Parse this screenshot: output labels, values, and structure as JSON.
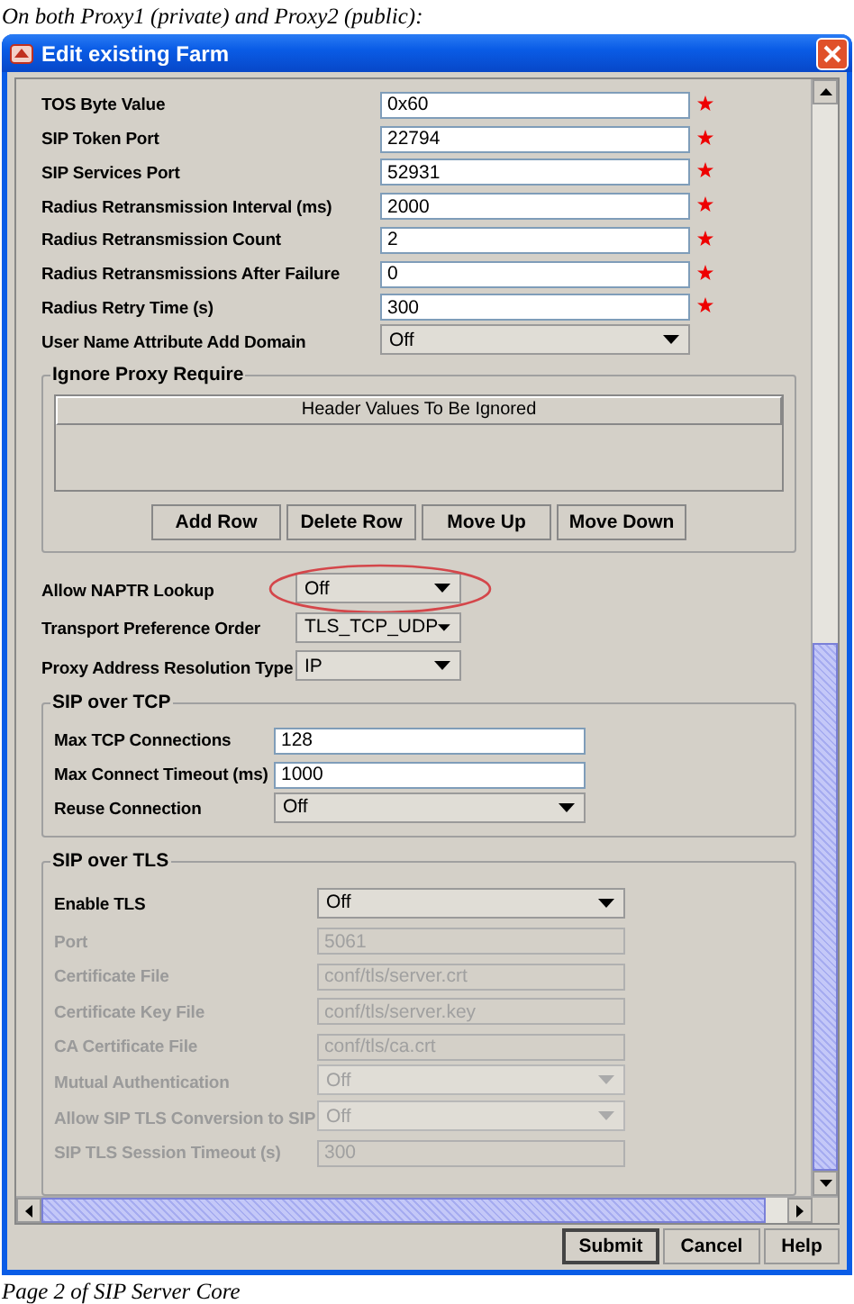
{
  "caption_top": "On both Proxy1 (private) and Proxy2 (public):",
  "window": {
    "title": "Edit existing Farm"
  },
  "fields": [
    {
      "label": "TOS Byte Value",
      "kind": "text",
      "value": "0x60",
      "required": true
    },
    {
      "label": "SIP Token Port",
      "kind": "text",
      "value": "22794",
      "required": true
    },
    {
      "label": "SIP Services Port",
      "kind": "text",
      "value": "52931",
      "required": true
    },
    {
      "label": "Radius Retransmission Interval (ms)",
      "kind": "text",
      "value": "2000",
      "required": true
    },
    {
      "label": "Radius Retransmission Count",
      "kind": "text",
      "value": "2",
      "required": true
    },
    {
      "label": "Radius Retransmissions After Failure",
      "kind": "text",
      "value": "0",
      "required": true
    },
    {
      "label": "Radius Retry Time (s)",
      "kind": "text",
      "value": "300",
      "required": true
    },
    {
      "label": "User Name Attribute Add Domain",
      "kind": "select",
      "value": "Off",
      "required": false
    }
  ],
  "ignore_proxy_require": {
    "title": "Ignore Proxy Require",
    "table": {
      "columns": [
        "Header Values To Be Ignored"
      ]
    },
    "buttons": [
      "Add Row",
      "Delete Row",
      "Move Up",
      "Move Down"
    ]
  },
  "options": [
    {
      "label": "Allow NAPTR Lookup",
      "kind": "select",
      "value": "Off",
      "circled": true
    },
    {
      "label": "Transport Preference Order",
      "kind": "select",
      "value": "TLS_TCP_UDP",
      "circled": false
    },
    {
      "label": "Proxy Address Resolution Type",
      "kind": "select",
      "value": "IP",
      "circled": false
    }
  ],
  "sip_over_tcp": {
    "title": "SIP over TCP",
    "fields": [
      {
        "label": "Max TCP Connections",
        "kind": "text",
        "value": "128"
      },
      {
        "label": "Max Connect Timeout (ms)",
        "kind": "text",
        "value": "1000"
      },
      {
        "label": "Reuse Connection",
        "kind": "select",
        "value": "Off"
      }
    ]
  },
  "sip_over_tls": {
    "title": "SIP over TLS",
    "fields": [
      {
        "label": "Enable TLS",
        "kind": "select",
        "value": "Off",
        "disabled": false
      },
      {
        "label": "Port",
        "kind": "text",
        "value": "5061",
        "disabled": true
      },
      {
        "label": "Certificate File",
        "kind": "text",
        "value": "conf/tls/server.crt",
        "disabled": true
      },
      {
        "label": "Certificate Key File",
        "kind": "text",
        "value": "conf/tls/server.key",
        "disabled": true
      },
      {
        "label": "CA Certificate File",
        "kind": "text",
        "value": "conf/tls/ca.crt",
        "disabled": true
      },
      {
        "label": "Mutual Authentication",
        "kind": "select",
        "value": "Off",
        "disabled": true
      },
      {
        "label": "Allow SIP TLS Conversion to SIP",
        "kind": "select",
        "value": "Off",
        "disabled": true
      },
      {
        "label": "SIP TLS Session Timeout (s)",
        "kind": "text",
        "value": "300",
        "disabled": true
      }
    ]
  },
  "buttons": [
    {
      "label": "Submit",
      "default": true
    },
    {
      "label": "Cancel",
      "default": false
    },
    {
      "label": "Help",
      "default": false
    }
  ],
  "caption_bottom": "Page 2 of SIP Server Core"
}
